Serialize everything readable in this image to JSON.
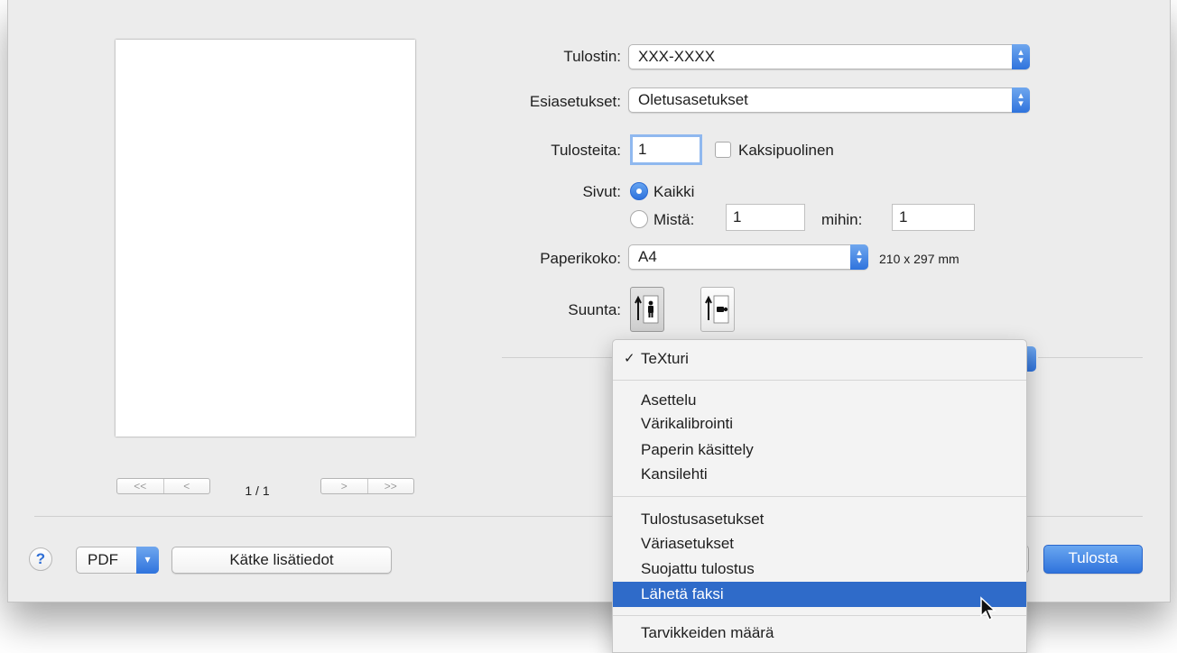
{
  "form": {
    "printer_label": "Tulostin:",
    "printer_value": "XXX-XXXX",
    "presets_label": "Esiasetukset:",
    "presets_value": "Oletusasetukset",
    "copies_label": "Tulosteita:",
    "copies_value": "1",
    "two_sided_label": "Kaksipuolinen",
    "pages_label": "Sivut:",
    "pages_all_label": "Kaikki",
    "pages_from_label": "Mistä:",
    "pages_from_value": "1",
    "pages_to_label": "mihin:",
    "pages_to_value": "1",
    "paper_size_label": "Paperikoko:",
    "paper_size_value": "A4",
    "paper_size_dims": "210 x 297 mm",
    "orientation_label": "Suunta:"
  },
  "preview": {
    "first_label": "<<",
    "prev_label": "<",
    "next_label": ">",
    "last_label": ">>",
    "page_count": "1 / 1"
  },
  "menu": {
    "checked_item": "TeXturi",
    "group1": [
      "Asettelu",
      "Värikalibrointi",
      "Paperin käsittely",
      "Kansilehti"
    ],
    "group2": [
      "Tulostusasetukset",
      "Väriasetukset",
      "Suojattu tulostus",
      "Lähetä faksi"
    ],
    "group3": [
      "Tarvikkeiden määrä"
    ],
    "highlighted_item": "Lähetä faksi"
  },
  "footer": {
    "help_label": "?",
    "pdf_label": "PDF",
    "hide_details_label": "Kätke lisätiedot",
    "print_label": "Tulosta"
  },
  "colors": {
    "accent": "#2f73dd",
    "highlight": "#2f6bc9",
    "dialog_bg": "#ececec"
  }
}
